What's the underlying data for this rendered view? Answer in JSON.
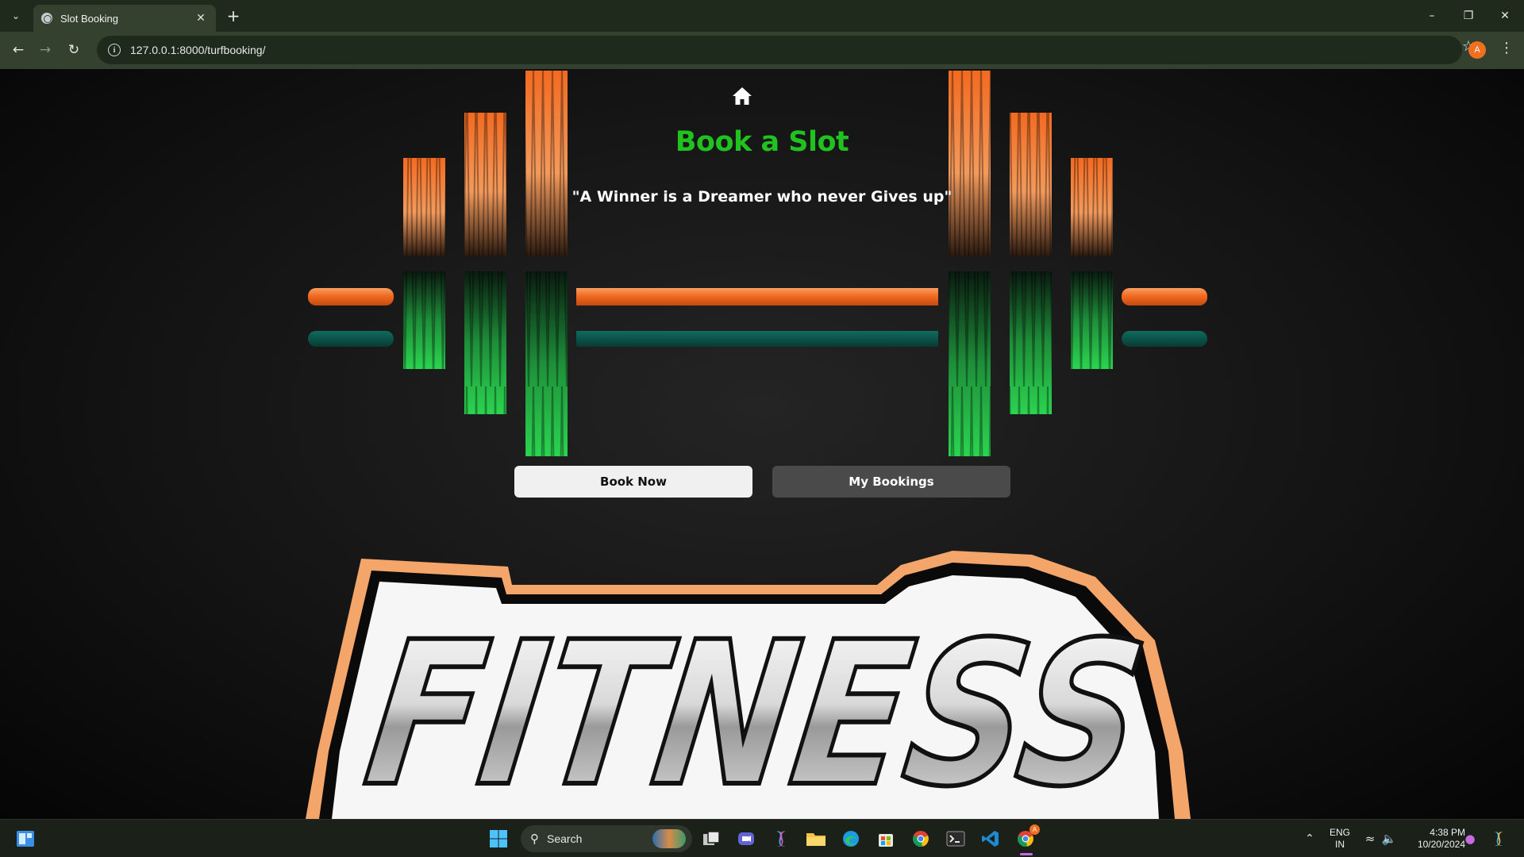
{
  "browser": {
    "tab_title": "Slot Booking",
    "url": "127.0.0.1:8000/turfbooking/",
    "profile_initial": "A"
  },
  "page": {
    "title": "Book a Slot",
    "quote": "\"A Winner is a Dreamer who never Gives up\"",
    "book_now_label": "Book Now",
    "my_bookings_label": "My Bookings",
    "logo_text": "FITNESS",
    "colors": {
      "title_green": "#1fc21f",
      "bar_orange": "#f26a21",
      "bar_teal": "#0d5f55",
      "plate_green": "#1fae3a"
    }
  },
  "taskbar": {
    "search_label": "Search",
    "language": "ENG",
    "region": "IN",
    "time": "4:38 PM",
    "date": "10/20/2024",
    "chrome_badge": "A"
  }
}
